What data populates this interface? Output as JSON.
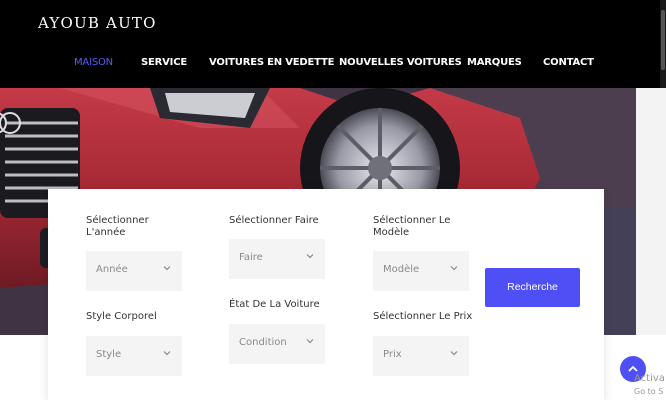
{
  "header": {
    "brand": "AYOUB AUTO",
    "nav": [
      {
        "label": "MAISON",
        "active": true
      },
      {
        "label": "SERVICE",
        "active": false
      },
      {
        "label": "VOITURES EN VEDETTE",
        "active": false
      },
      {
        "label": "NOUVELLES VOITURES",
        "active": false
      },
      {
        "label": "MARQUES",
        "active": false
      },
      {
        "label": "CONTACT",
        "active": false
      }
    ]
  },
  "search": {
    "fields": [
      {
        "label": "Sélectionner L'année",
        "value": "Année"
      },
      {
        "label": "Sélectionner Faire",
        "value": "Faire"
      },
      {
        "label": "Sélectionner Le Modèle",
        "value": "Modèle"
      },
      {
        "label": "Style Corporel",
        "value": "Style"
      },
      {
        "label": "État De La Voiture",
        "value": "Condition"
      },
      {
        "label": "Sélectionner Le Prix",
        "value": "Prix"
      }
    ],
    "button_label": "Recherche"
  },
  "overlay": {
    "activate_line1": "Activa",
    "activate_line2": "Go to S"
  },
  "colors": {
    "accent": "#4f4ff6",
    "nav_active": "#5a5cf0",
    "header_bg": "#000000",
    "car": "#b8303e"
  },
  "icons": [
    "chevron-down-icon",
    "arrow-up-icon"
  ]
}
